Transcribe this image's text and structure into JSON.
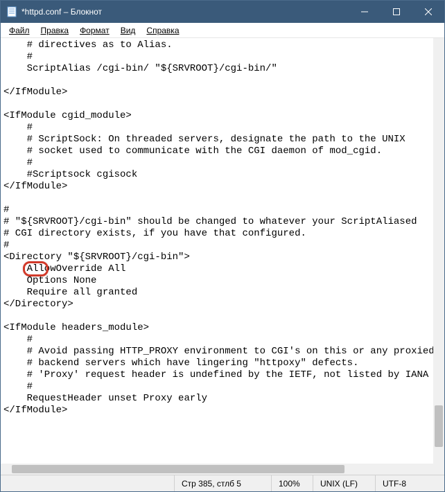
{
  "titlebar": {
    "title": "*httpd.conf – Блокнот"
  },
  "menu": {
    "file": "Файл",
    "edit": "Правка",
    "format": "Формат",
    "view": "Вид",
    "help": "Справка"
  },
  "editor": {
    "content": "    # directives as to Alias.\n    #\n    ScriptAlias /cgi-bin/ \"${SRVROOT}/cgi-bin/\"\n\n</IfModule>\n\n<IfModule cgid_module>\n    #\n    # ScriptSock: On threaded servers, designate the path to the UNIX\n    # socket used to communicate with the CGI daemon of mod_cgid.\n    #\n    #Scriptsock cgisock\n</IfModule>\n\n#\n# \"${SRVROOT}/cgi-bin\" should be changed to whatever your ScriptAliased\n# CGI directory exists, if you have that configured.\n#\n<Directory \"${SRVROOT}/cgi-bin\">\n    AllowOverride All\n    Options None\n    Require all granted\n</Directory>\n\n<IfModule headers_module>\n    #\n    # Avoid passing HTTP_PROXY environment to CGI's on this or any proxied\n    # backend servers which have lingering \"httpoxy\" defects.\n    # 'Proxy' request header is undefined by the IETF, not listed by IANA\n    #\n    RequestHeader unset Proxy early\n</IfModule>\n",
    "highlight_word": "All"
  },
  "statusbar": {
    "position": "Стр 385, стлб 5",
    "zoom": "100%",
    "line_ending": "UNIX (LF)",
    "encoding": "UTF-8"
  }
}
